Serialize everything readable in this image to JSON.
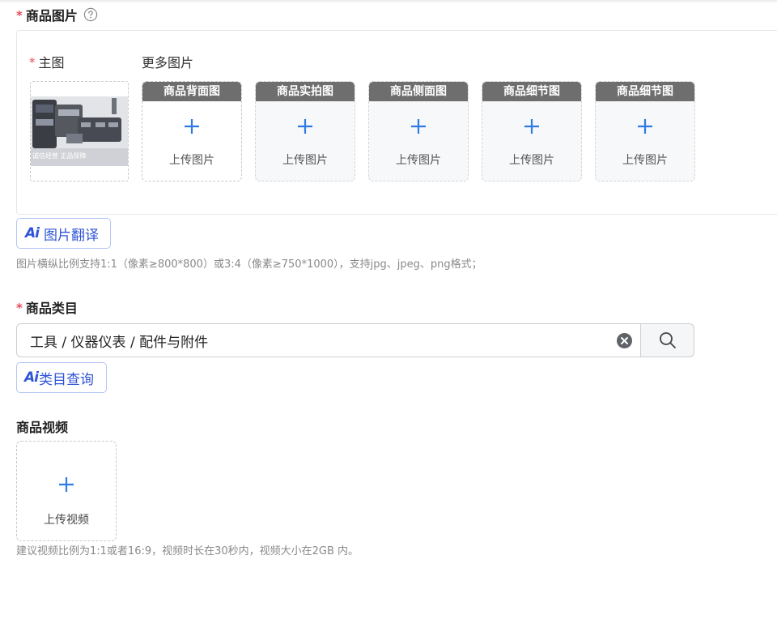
{
  "product_images": {
    "label": "商品图片",
    "required_mark": "*",
    "help_icon": "question-circle-icon",
    "main_label": "主图",
    "more_label": "更多图片",
    "main_image_watermark": "诚信经营 正品保障",
    "slots": [
      {
        "title": "商品背面图",
        "upload_text": "上传图片"
      },
      {
        "title": "商品实拍图",
        "upload_text": "上传图片"
      },
      {
        "title": "商品侧面图",
        "upload_text": "上传图片"
      },
      {
        "title": "商品细节图",
        "upload_text": "上传图片"
      },
      {
        "title": "商品细节图",
        "upload_text": "上传图片"
      }
    ],
    "ai_translate_label": "图片翻译",
    "ai_mark": "Ai",
    "hint": "图片横纵比例支持1:1（像素≥800*800）或3:4（像素≥750*1000），支持jpg、jpeg、png格式；"
  },
  "category": {
    "label": "商品类目",
    "required_mark": "*",
    "value": "工具 / 仪器仪表 / 配件与附件",
    "ai_query_label": "类目查询",
    "ai_mark": "Ai"
  },
  "video": {
    "label": "商品视频",
    "upload_text": "上传视频",
    "hint": "建议视频比例为1:1或者16:9，视频时长在30秒内，视频大小在2GB 内。"
  },
  "colors": {
    "accent": "#2f7be5",
    "required": "#e34d59",
    "ai_blue": "#2f54d6",
    "slot_header": "#6e6e6e"
  }
}
